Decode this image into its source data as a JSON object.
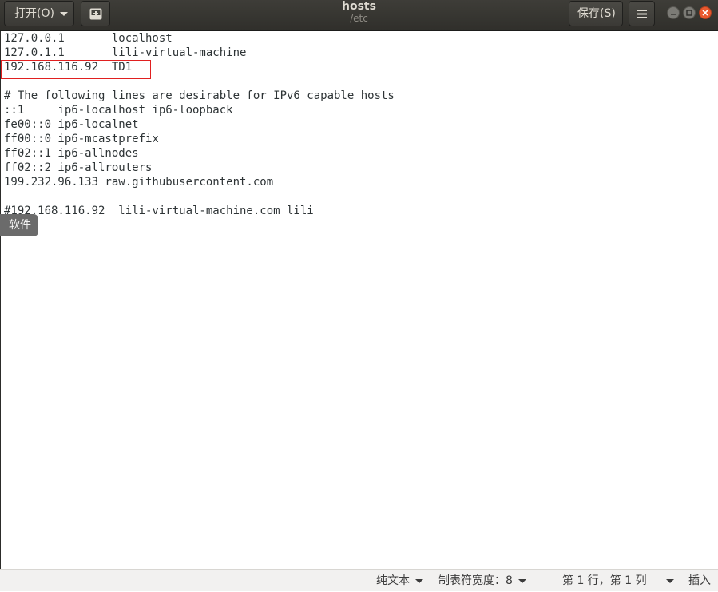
{
  "window": {
    "title": "hosts",
    "subtitle": "/etc"
  },
  "toolbar": {
    "open_label": "打开(O)",
    "save_label": "保存(S)"
  },
  "editor": {
    "lines": [
      "127.0.0.1       localhost",
      "127.0.1.1       lili-virtual-machine",
      "192.168.116.92  TD1",
      "",
      "# The following lines are desirable for IPv6 capable hosts",
      "::1     ip6-localhost ip6-loopback",
      "fe00::0 ip6-localnet",
      "ff00::0 ip6-mcastprefix",
      "ff02::1 ip6-allnodes",
      "ff02::2 ip6-allrouters",
      "199.232.96.133 raw.githubusercontent.com",
      "",
      "#192.168.116.92  lili-virtual-machine.com lili"
    ]
  },
  "tooltip": {
    "text": "软件"
  },
  "statusbar": {
    "language": "纯文本",
    "tab_width": "制表符宽度：8",
    "position": "第 1 行，第 1 列",
    "mode": "插入"
  },
  "colors": {
    "header_bg": "#353430",
    "close_button": "#e9592f",
    "highlight_border": "#e02020",
    "statusbar_bg": "#f2f1f0",
    "text": "#2e3436"
  },
  "icons": [
    "caret-down-icon",
    "new-tab-icon",
    "hamburger-menu-icon",
    "minimize-icon",
    "maximize-icon",
    "close-icon"
  ]
}
